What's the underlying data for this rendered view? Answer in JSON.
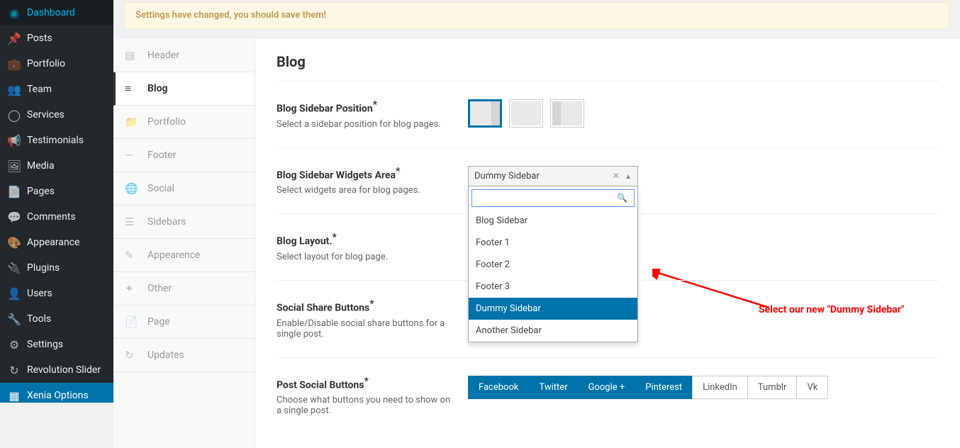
{
  "wp_menu": [
    {
      "icon": "◉",
      "label": "Dashboard",
      "name": "dashboard"
    },
    {
      "icon": "📌",
      "label": "Posts",
      "name": "posts"
    },
    {
      "icon": "💼",
      "label": "Portfolio",
      "name": "portfolio"
    },
    {
      "icon": "👥",
      "label": "Team",
      "name": "team"
    },
    {
      "icon": "◯",
      "label": "Services",
      "name": "services"
    },
    {
      "icon": "📢",
      "label": "Testimonials",
      "name": "testimonials"
    },
    {
      "icon": "🖼",
      "label": "Media",
      "name": "media"
    },
    {
      "icon": "📄",
      "label": "Pages",
      "name": "pages"
    },
    {
      "icon": "💬",
      "label": "Comments",
      "name": "comments"
    },
    {
      "icon": "🎨",
      "label": "Appearance",
      "name": "appearance"
    },
    {
      "icon": "🔌",
      "label": "Plugins",
      "name": "plugins"
    },
    {
      "icon": "👤",
      "label": "Users",
      "name": "users"
    },
    {
      "icon": "🔧",
      "label": "Tools",
      "name": "tools"
    },
    {
      "icon": "⚙",
      "label": "Settings",
      "name": "settings"
    },
    {
      "icon": "↻",
      "label": "Revolution Slider",
      "name": "revolution-slider"
    },
    {
      "icon": "▦",
      "label": "Xenia Options",
      "name": "xenia-options",
      "active": true
    }
  ],
  "notice": "Settings have changed, you should save them!",
  "sections": [
    {
      "icon": "▤",
      "label": "Header",
      "name": "header"
    },
    {
      "icon": "≡",
      "label": "Blog",
      "name": "blog",
      "active": true
    },
    {
      "icon": "📁",
      "label": "Portfolio",
      "name": "portfolio"
    },
    {
      "icon": "—",
      "label": "Footer",
      "name": "footer"
    },
    {
      "icon": "🌐",
      "label": "Social",
      "name": "social"
    },
    {
      "icon": "☰",
      "label": "Sidebars",
      "name": "sidebars"
    },
    {
      "icon": "✎",
      "label": "Appearence",
      "name": "appearence"
    },
    {
      "icon": "✦",
      "label": "Other",
      "name": "other"
    },
    {
      "icon": "📄",
      "label": "Page",
      "name": "page"
    },
    {
      "icon": "↻",
      "label": "Updates",
      "name": "updates"
    }
  ],
  "panel": {
    "title": "Blog",
    "fields": {
      "sidebar_position": {
        "label": "Blog Sidebar Position",
        "desc": "Select a sidebar position for blog pages."
      },
      "widgets_area": {
        "label": "Blog Sidebar Widgets Area",
        "desc": "Select widgets area for blog pages.",
        "selected": "Dummy Sidebar",
        "search_value": "",
        "options": [
          "Blog Sidebar",
          "Footer 1",
          "Footer 2",
          "Footer 3",
          "Dummy Sidebar",
          "Another Sidebar"
        ],
        "highlighted_index": 4
      },
      "layout": {
        "label": "Blog Layout.",
        "desc": "Select layout for blog page."
      },
      "share": {
        "label": "Social Share Buttons",
        "desc": "Enable/Disable social share buttons for a single post."
      },
      "social_buttons": {
        "label": "Post Social Buttons",
        "desc": "Choose what buttons you need to show on a single post.",
        "buttons": [
          {
            "label": "Facebook",
            "on": true
          },
          {
            "label": "Twitter",
            "on": true
          },
          {
            "label": "Google +",
            "on": true
          },
          {
            "label": "Pinterest",
            "on": true
          },
          {
            "label": "LinkedIn",
            "on": false
          },
          {
            "label": "Tumblr",
            "on": false
          },
          {
            "label": "Vk",
            "on": false
          }
        ]
      }
    }
  },
  "annotation": "Select our new \"Dummy Sidebar\""
}
